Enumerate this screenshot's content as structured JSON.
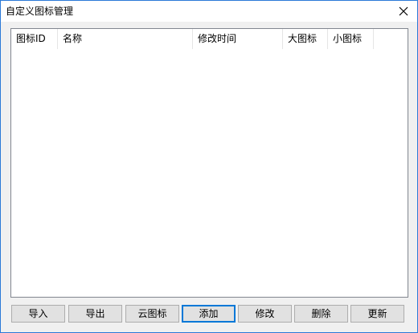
{
  "window": {
    "title": "自定义图标管理"
  },
  "listview": {
    "columns": [
      {
        "label": "图标ID"
      },
      {
        "label": "名称"
      },
      {
        "label": "修改时间"
      },
      {
        "label": "大图标"
      },
      {
        "label": "小图标"
      }
    ],
    "rows": []
  },
  "buttons": {
    "import_label": "导入",
    "export_label": "导出",
    "cloud_icon_label": "云图标",
    "add_label": "添加",
    "edit_label": "修改",
    "delete_label": "删除",
    "update_label": "更新"
  },
  "icons": {
    "close": "close-icon"
  },
  "colors": {
    "window_border": "#2b79d8",
    "default_button_border": "#0078d7",
    "button_face": "#e1e1e1",
    "dialog_background": "#f0f0f0"
  }
}
